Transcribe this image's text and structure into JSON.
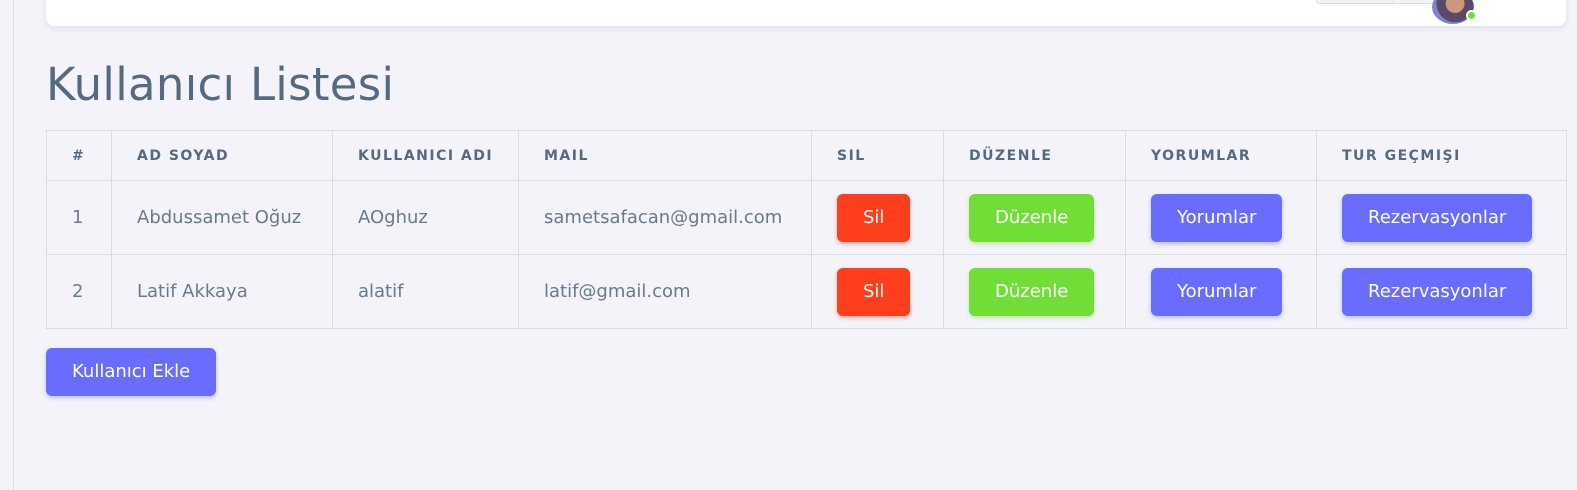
{
  "page": {
    "title": "Kullanıcı Listesi"
  },
  "table": {
    "headers": [
      "#",
      "AD SOYAD",
      "KULLANICI ADI",
      "MAIL",
      "SIL",
      "DÜZENLE",
      "YORUMLAR",
      "TUR GEÇMIŞI"
    ],
    "rows": [
      {
        "index": "1",
        "full_name": "Abdussamet Oğuz",
        "username": "AOghuz",
        "mail": "sametsafacan@gmail.com",
        "delete_label": "Sil",
        "edit_label": "Düzenle",
        "comments_label": "Yorumlar",
        "reservations_label": "Rezervasyonlar"
      },
      {
        "index": "2",
        "full_name": "Latif Akkaya",
        "username": "alatif",
        "mail": "latif@gmail.com",
        "delete_label": "Sil",
        "edit_label": "Düzenle",
        "comments_label": "Yorumlar",
        "reservations_label": "Rezervasyonlar"
      }
    ]
  },
  "actions": {
    "add_user_label": "Kullanıcı Ekle"
  },
  "colors": {
    "danger": "#ff3e1d",
    "success": "#71dd37",
    "primary": "#696cff",
    "background": "#f3f3f9"
  }
}
